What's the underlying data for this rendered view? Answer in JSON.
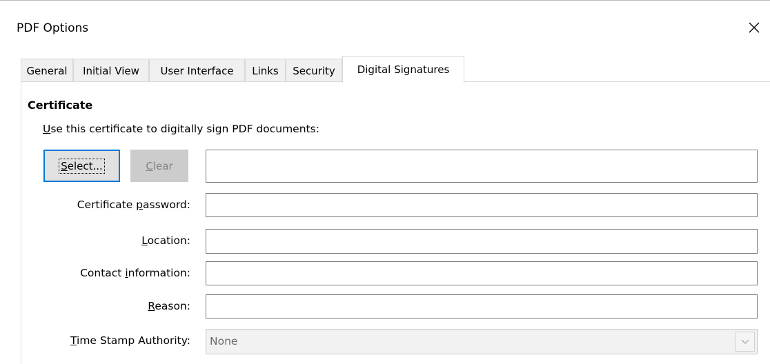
{
  "window": {
    "title": "PDF Options",
    "close_icon": "close-icon"
  },
  "tabs": [
    {
      "label": "General"
    },
    {
      "label": "Initial View"
    },
    {
      "label": "User Interface"
    },
    {
      "label": "Links"
    },
    {
      "label": "Security"
    },
    {
      "label": "Digital Signatures",
      "active": true
    }
  ],
  "certificate": {
    "heading": "Certificate",
    "intro_mnemonic": "U",
    "intro_rest": "se this certificate to digitally sign PDF documents:",
    "select_mnemonic": "S",
    "select_rest": "elect...",
    "clear_mnemonic": "C",
    "clear_rest": "lear",
    "certificate_value": ""
  },
  "fields": {
    "password": {
      "pre": "Certificate ",
      "mnemonic": "p",
      "post": "assword:",
      "value": ""
    },
    "location": {
      "pre": "",
      "mnemonic": "L",
      "post": "ocation:",
      "value": ""
    },
    "contact": {
      "pre": "Contact ",
      "mnemonic": "i",
      "post": "nformation:",
      "value": ""
    },
    "reason": {
      "pre": "",
      "mnemonic": "R",
      "post": "eason:",
      "value": ""
    },
    "tsa": {
      "pre": "",
      "mnemonic": "T",
      "post": "ime Stamp Authority:",
      "selected": "None"
    }
  },
  "colors": {
    "focus_accent": "#0078d7",
    "disabled_text": "#838383"
  }
}
